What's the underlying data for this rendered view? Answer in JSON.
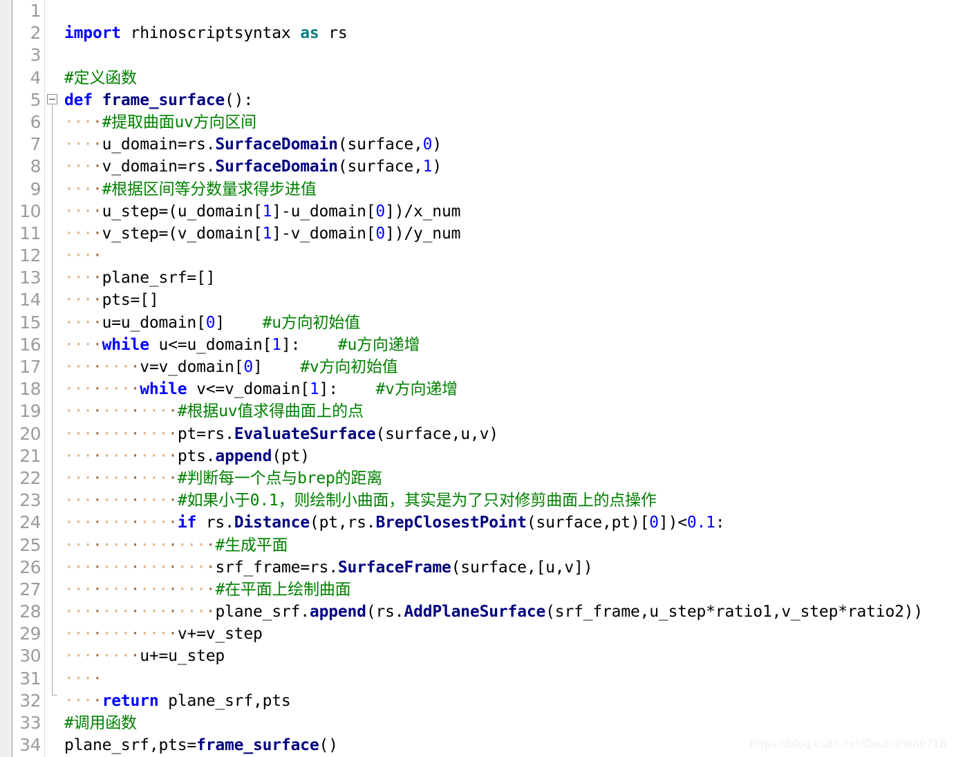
{
  "editor": {
    "title": "Python code editor",
    "language": "Python",
    "first_line": 1,
    "last_line": 34,
    "total_lines": 34,
    "colors": {
      "background": "#ffffff",
      "gutter_text": "#9b9b9b",
      "margin_strip": "#eeeeee",
      "keyword": "#0000ff",
      "keyword_alt": "#008080",
      "function": "#000080",
      "number": "#0000ff",
      "comment": "#008000",
      "text": "#000000",
      "indent_dot": "#e3b07d",
      "indent_dot_marker": "#9c6b40",
      "fold_line": "#a8a8a8",
      "watermark": "#efefef"
    }
  },
  "gutter": {
    "line_numbers": [
      "1",
      "2",
      "3",
      "4",
      "5",
      "6",
      "7",
      "8",
      "9",
      "10",
      "11",
      "12",
      "13",
      "14",
      "15",
      "16",
      "17",
      "18",
      "19",
      "20",
      "21",
      "22",
      "23",
      "24",
      "25",
      "26",
      "27",
      "28",
      "29",
      "30",
      "31",
      "32",
      "33",
      "34"
    ]
  },
  "fold": {
    "marker_line": 5,
    "marker_glyph": "minus",
    "region_start_line": 5,
    "region_end_line": 32
  },
  "code": {
    "lines": [
      {
        "n": 1,
        "indent": 0,
        "text": ""
      },
      {
        "n": 2,
        "indent": 0,
        "text": "import rhinoscriptsyntax as rs"
      },
      {
        "n": 3,
        "indent": 0,
        "text": ""
      },
      {
        "n": 4,
        "indent": 0,
        "text": "#定义函数"
      },
      {
        "n": 5,
        "indent": 0,
        "text": "def frame_surface():"
      },
      {
        "n": 6,
        "indent": 4,
        "text": "#提取曲面uv方向区间"
      },
      {
        "n": 7,
        "indent": 4,
        "text": "u_domain=rs.SurfaceDomain(surface,0)"
      },
      {
        "n": 8,
        "indent": 4,
        "text": "v_domain=rs.SurfaceDomain(surface,1)"
      },
      {
        "n": 9,
        "indent": 4,
        "text": "#根据区间等分数量求得步进值"
      },
      {
        "n": 10,
        "indent": 4,
        "text": "u_step=(u_domain[1]-u_domain[0])/x_num"
      },
      {
        "n": 11,
        "indent": 4,
        "text": "v_step=(v_domain[1]-v_domain[0])/y_num"
      },
      {
        "n": 12,
        "indent": 4,
        "text": ""
      },
      {
        "n": 13,
        "indent": 4,
        "text": "plane_srf=[]"
      },
      {
        "n": 14,
        "indent": 4,
        "text": "pts=[]"
      },
      {
        "n": 15,
        "indent": 4,
        "text": "u=u_domain[0]    #u方向初始值"
      },
      {
        "n": 16,
        "indent": 4,
        "text": "while u<=u_domain[1]:    #u方向递增"
      },
      {
        "n": 17,
        "indent": 8,
        "text": "v=v_domain[0]    #v方向初始值"
      },
      {
        "n": 18,
        "indent": 8,
        "text": "while v<=v_domain[1]:    #v方向递增"
      },
      {
        "n": 19,
        "indent": 12,
        "text": "#根据uv值求得曲面上的点"
      },
      {
        "n": 20,
        "indent": 12,
        "text": "pt=rs.EvaluateSurface(surface,u,v)"
      },
      {
        "n": 21,
        "indent": 12,
        "text": "pts.append(pt)"
      },
      {
        "n": 22,
        "indent": 12,
        "text": "#判断每一个点与brep的距离"
      },
      {
        "n": 23,
        "indent": 12,
        "text": "#如果小于0.1，则绘制小曲面，其实是为了只对修剪曲面上的点操作"
      },
      {
        "n": 24,
        "indent": 12,
        "text": "if rs.Distance(pt,rs.BrepClosestPoint(surface,pt)[0])<0.1:"
      },
      {
        "n": 25,
        "indent": 16,
        "text": "#生成平面"
      },
      {
        "n": 26,
        "indent": 16,
        "text": "srf_frame=rs.SurfaceFrame(surface,[u,v])"
      },
      {
        "n": 27,
        "indent": 16,
        "text": "#在平面上绘制曲面"
      },
      {
        "n": 28,
        "indent": 16,
        "text": "plane_srf.append(rs.AddPlaneSurface(srf_frame,u_step*ratio1,v_step*ratio2))"
      },
      {
        "n": 29,
        "indent": 12,
        "text": "v+=v_step"
      },
      {
        "n": 30,
        "indent": 8,
        "text": "u+=u_step"
      },
      {
        "n": 31,
        "indent": 4,
        "text": ""
      },
      {
        "n": 32,
        "indent": 4,
        "text": "return plane_srf,pts"
      },
      {
        "n": 33,
        "indent": 0,
        "text": "#调用函数"
      },
      {
        "n": 34,
        "indent": 0,
        "text": "plane_srf,pts=frame_surface()"
      }
    ]
  },
  "watermark": {
    "text": "https://blog.csdn.net/DoubleYan0718"
  }
}
